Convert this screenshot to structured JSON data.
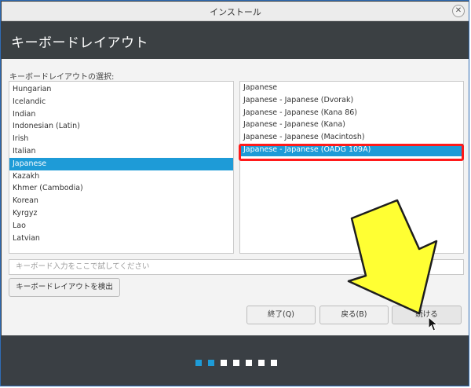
{
  "window": {
    "title": "インストール",
    "close_glyph": "✕"
  },
  "header": {
    "title": "キーボードレイアウト"
  },
  "section_label": "キーボードレイアウトの選択:",
  "left_list": {
    "items": [
      "Hungarian",
      "Icelandic",
      "Indian",
      "Indonesian (Latin)",
      "Irish",
      "Italian",
      "Japanese",
      "Kazakh",
      "Khmer (Cambodia)",
      "Korean",
      "Kyrgyz",
      "Lao",
      "Latvian"
    ],
    "selected": "Japanese"
  },
  "right_list": {
    "items": [
      "Japanese",
      "Japanese - Japanese (Dvorak)",
      "Japanese - Japanese (Kana 86)",
      "Japanese - Japanese (Kana)",
      "Japanese - Japanese (Macintosh)",
      "Japanese - Japanese (OADG 109A)"
    ],
    "selected": "Japanese - Japanese (OADG 109A)"
  },
  "test_input": {
    "placeholder": "キーボード入力をここで試してください",
    "value": ""
  },
  "buttons": {
    "detect": "キーボードレイアウトを検出",
    "quit": "終了(Q)",
    "back": "戻る(B)",
    "continue": "続ける"
  },
  "progress": {
    "total_steps": 7,
    "completed_steps": 2
  },
  "colors": {
    "accent": "#1e9bd7",
    "header_bg": "#3b4043",
    "highlight_border": "#ff1a1a",
    "arrow_fill": "#ffff33"
  },
  "icons": {
    "close": "close-icon",
    "annotation": "arrow-down-icon",
    "cursor": "mouse-pointer-icon"
  }
}
